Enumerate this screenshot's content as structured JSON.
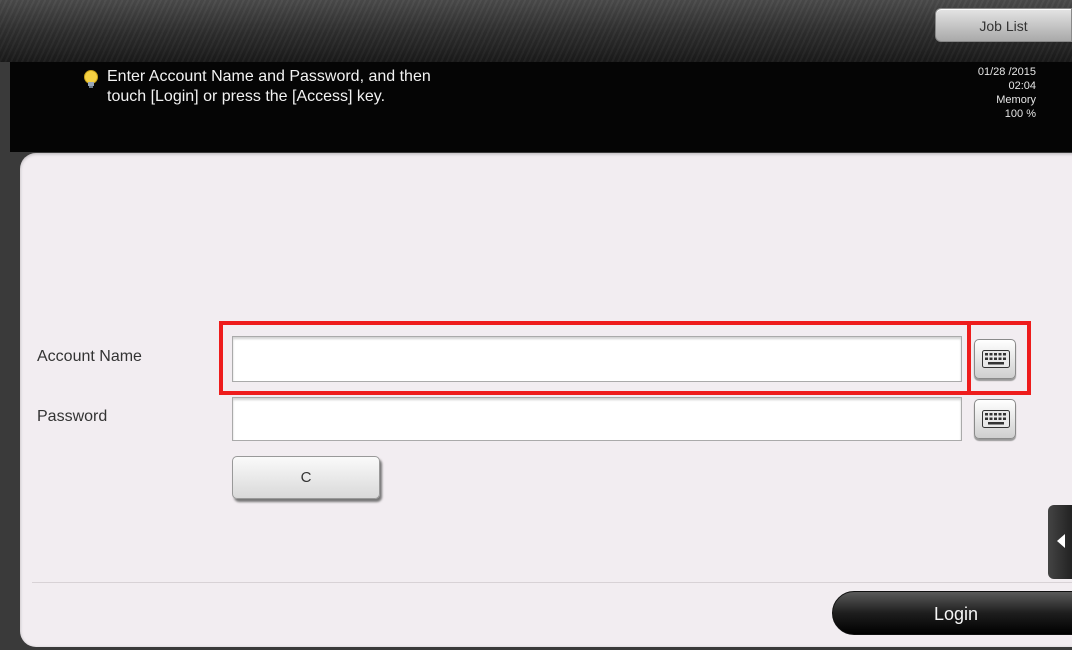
{
  "header": {
    "job_list_label": "Job List",
    "message": "Enter Account Name and Password, and then\ntouch [Login] or press the [Access] key.",
    "date": "01/28 /2015",
    "time": "02:04",
    "memory_label": "Memory",
    "memory_value": "100 %"
  },
  "form": {
    "account_name": {
      "label": "Account Name",
      "value": ""
    },
    "password": {
      "label": "Password",
      "value": ""
    },
    "clear_label": "C",
    "login_label": "Login"
  },
  "icons": {
    "tip": "lightbulb-icon",
    "keyboard": "keyboard-icon",
    "side_tab": "arrow-left-icon"
  },
  "colors": {
    "highlight": "#ee1c1c",
    "panel_bg": "#f2edf1",
    "message_bg": "#050505"
  }
}
